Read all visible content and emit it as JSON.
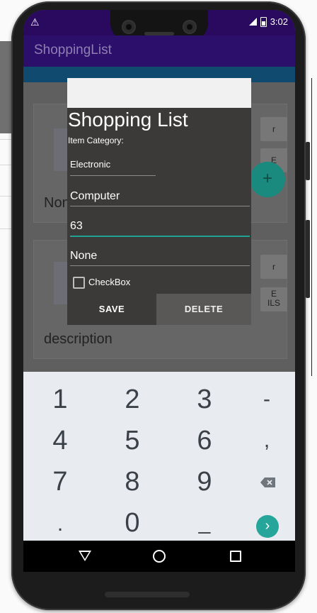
{
  "status_bar": {
    "time": "3:02",
    "warning_glyph": "⚠"
  },
  "app_bar": {
    "title": "ShoppingList"
  },
  "background_list": {
    "cards": [
      {
        "text": "None",
        "button_label": "r",
        "button2_label": "E"
      },
      {
        "text": "description",
        "button_label": "r",
        "button2_label": "E\nILS"
      }
    ],
    "fab_icon": "plus-icon"
  },
  "dialog": {
    "title": "Shopping List",
    "category_label": "Item Category:",
    "category_value": "Electronic",
    "name_value": "Computer",
    "quantity_value": "63",
    "description_value": "None",
    "checkbox_label": "CheckBox",
    "checkbox_checked": false,
    "save_label": "SAVE",
    "delete_label": "DELETE"
  },
  "keypad": {
    "row1": [
      "1",
      "2",
      "3",
      "-"
    ],
    "row2": [
      "4",
      "5",
      "6",
      ","
    ],
    "row3": [
      "7",
      "8",
      "9"
    ],
    "row4": [
      ".",
      "0",
      "_"
    ],
    "enter_glyph": "›",
    "backspace_icon": "backspace-icon",
    "accent_color": "#26a69a"
  },
  "colors": {
    "app_bar": "#2c0f6b",
    "status_bar": "#2a0a5e",
    "field_accent": "#1fa193"
  }
}
